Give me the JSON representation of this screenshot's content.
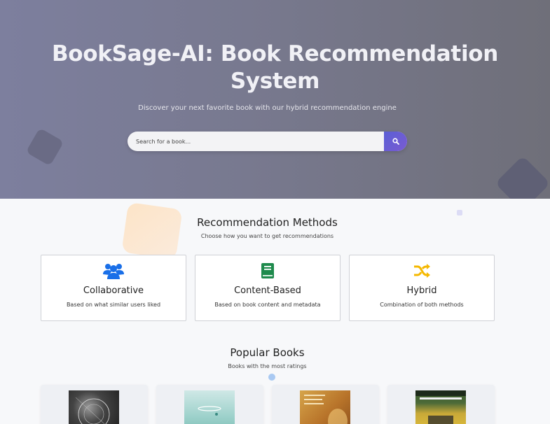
{
  "hero": {
    "title": "BookSage-AI: Book Recommendation System",
    "subtitle": "Discover your next favorite book with our hybrid recommendation engine",
    "search": {
      "placeholder": "Search for a book..."
    }
  },
  "methods": {
    "title": "Recommendation Methods",
    "subtitle": "Choose how you want to get recommendations",
    "items": [
      {
        "title": "Collaborative",
        "description": "Based on what similar users liked",
        "icon": "users-icon",
        "color": "#1a6fe8"
      },
      {
        "title": "Content-Based",
        "description": "Based on book content and metadata",
        "icon": "book-icon",
        "color": "#1e8a4c"
      },
      {
        "title": "Hybrid",
        "description": "Combination of both methods",
        "icon": "shuffle-icon",
        "color": "#f5b800"
      }
    ]
  },
  "popular": {
    "title": "Popular Books",
    "subtitle": "Books with the most ratings"
  },
  "colors": {
    "accent": "#5b5fd6",
    "hero_bg": "#7a7b93"
  }
}
